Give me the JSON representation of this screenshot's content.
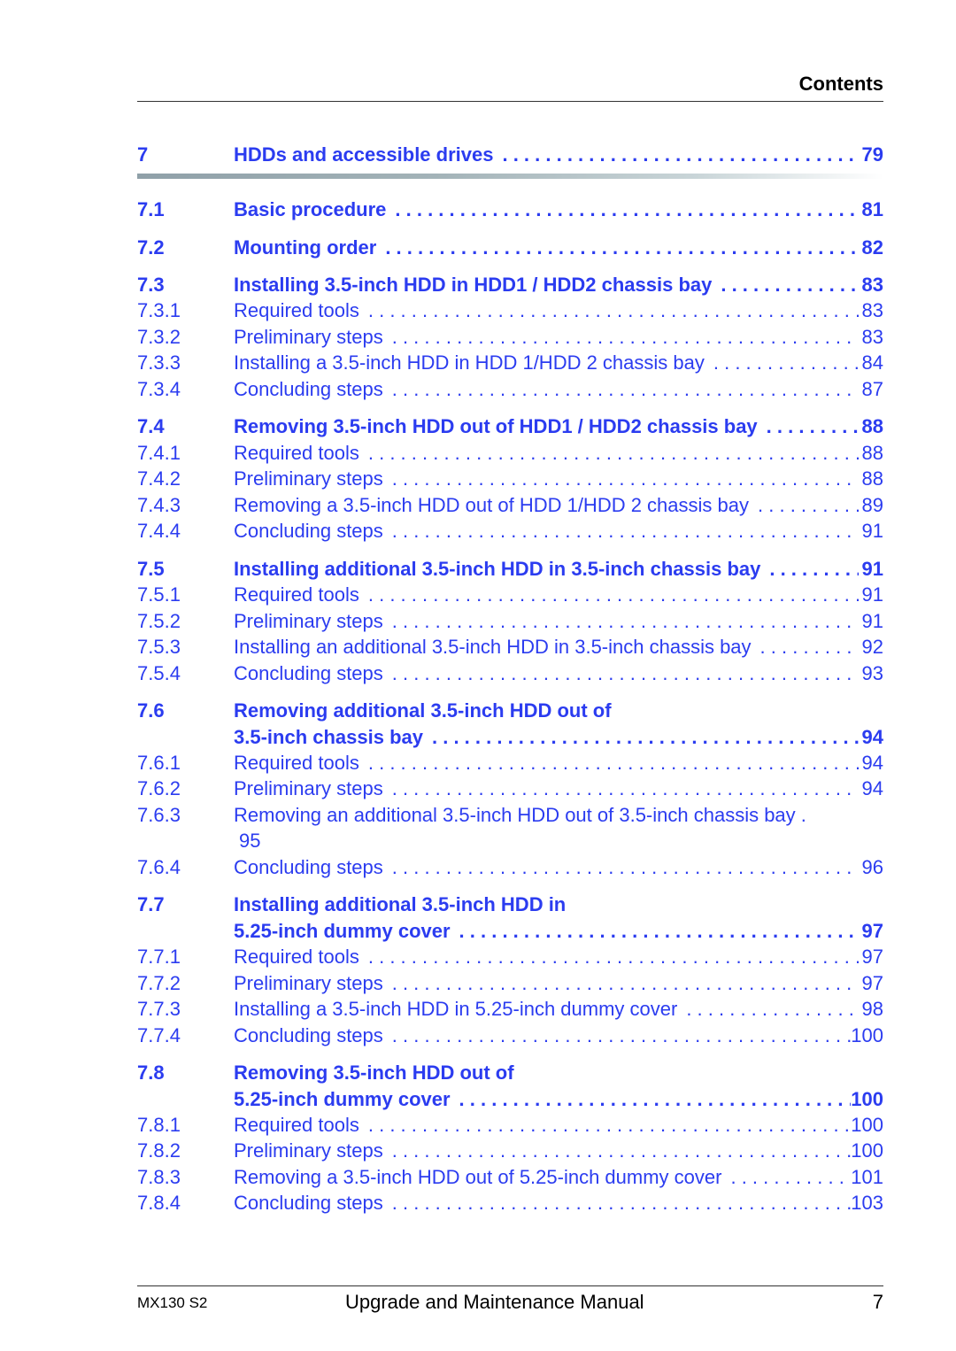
{
  "header": {
    "title": "Contents"
  },
  "colors": {
    "link": "#2B3CF0",
    "text": "#000000"
  },
  "toc": [
    {
      "num": "7",
      "title": "HDDs and accessible drives",
      "page": "79",
      "level": 1
    },
    {
      "num": "7.1",
      "title": "Basic procedure",
      "page": "81",
      "level": 2
    },
    {
      "num": "7.2",
      "title": "Mounting order",
      "page": "82",
      "level": 2
    },
    {
      "num": "7.3",
      "title": "Installing 3.5-inch HDD in HDD1 / HDD2 chassis bay",
      "page": "83",
      "level": 2
    },
    {
      "num": "7.3.1",
      "title": "Required tools",
      "page": "83",
      "level": 3
    },
    {
      "num": "7.3.2",
      "title": "Preliminary steps",
      "page": "83",
      "level": 3
    },
    {
      "num": "7.3.3",
      "title": "Installing a 3.5-inch HDD in HDD 1/HDD 2 chassis bay",
      "page": "84",
      "level": 3
    },
    {
      "num": "7.3.4",
      "title": "Concluding steps",
      "page": "87",
      "level": 3
    },
    {
      "num": "7.4",
      "title": "Removing 3.5-inch HDD out of HDD1 / HDD2 chassis bay",
      "page": "88",
      "level": 2
    },
    {
      "num": "7.4.1",
      "title": "Required tools",
      "page": "88",
      "level": 3
    },
    {
      "num": "7.4.2",
      "title": "Preliminary steps",
      "page": "88",
      "level": 3
    },
    {
      "num": "7.4.3",
      "title": "Removing a 3.5-inch HDD out of HDD 1/HDD 2 chassis bay",
      "page": "89",
      "level": 3
    },
    {
      "num": "7.4.4",
      "title": "Concluding steps",
      "page": "91",
      "level": 3
    },
    {
      "num": "7.5",
      "title": "Installing additional 3.5-inch HDD in 3.5-inch chassis bay",
      "page": "91",
      "level": 2
    },
    {
      "num": "7.5.1",
      "title": "Required tools",
      "page": "91",
      "level": 3
    },
    {
      "num": "7.5.2",
      "title": "Preliminary steps",
      "page": "91",
      "level": 3
    },
    {
      "num": "7.5.3",
      "title": "Installing an additional 3.5-inch HDD in 3.5-inch chassis bay",
      "page": "92",
      "level": 3
    },
    {
      "num": "7.5.4",
      "title": "Concluding steps",
      "page": "93",
      "level": 3
    },
    {
      "num": "7.6",
      "title": "Removing additional 3.5-inch HDD out of",
      "title_line2": "3.5-inch chassis bay",
      "page": "94",
      "level": 2
    },
    {
      "num": "7.6.1",
      "title": "Required tools",
      "page": "94",
      "level": 3
    },
    {
      "num": "7.6.2",
      "title": "Preliminary steps",
      "page": "94",
      "level": 3
    },
    {
      "num": "7.6.3",
      "title": "Removing an additional 3.5-inch HDD out of 3.5-inch chassis bay",
      "page": "95",
      "level": 3
    },
    {
      "num": "7.6.4",
      "title": "Concluding steps",
      "page": "96",
      "level": 3
    },
    {
      "num": "7.7",
      "title": "Installing additional 3.5-inch HDD in",
      "title_line2": "5.25-inch dummy cover",
      "page": "97",
      "level": 2
    },
    {
      "num": "7.7.1",
      "title": "Required tools",
      "page": "97",
      "level": 3
    },
    {
      "num": "7.7.2",
      "title": "Preliminary steps",
      "page": "97",
      "level": 3
    },
    {
      "num": "7.7.3",
      "title": "Installing a 3.5-inch HDD in 5.25-inch dummy cover",
      "page": "98",
      "level": 3
    },
    {
      "num": "7.7.4",
      "title": "Concluding steps",
      "page": "100",
      "level": 3
    },
    {
      "num": "7.8",
      "title": "Removing 3.5-inch HDD out of",
      "title_line2": "5.25-inch dummy cover",
      "page": "100",
      "level": 2
    },
    {
      "num": "7.8.1",
      "title": "Required tools",
      "page": "100",
      "level": 3
    },
    {
      "num": "7.8.2",
      "title": "Preliminary steps",
      "page": "100",
      "level": 3
    },
    {
      "num": "7.8.3",
      "title": "Removing a 3.5-inch HDD out of 5.25-inch dummy cover",
      "page": "101",
      "level": 3
    },
    {
      "num": "7.8.4",
      "title": "Concluding steps",
      "page": "103",
      "level": 3
    }
  ],
  "footer": {
    "product": "MX130 S2",
    "manual": "Upgrade and Maintenance Manual",
    "page": "7"
  }
}
